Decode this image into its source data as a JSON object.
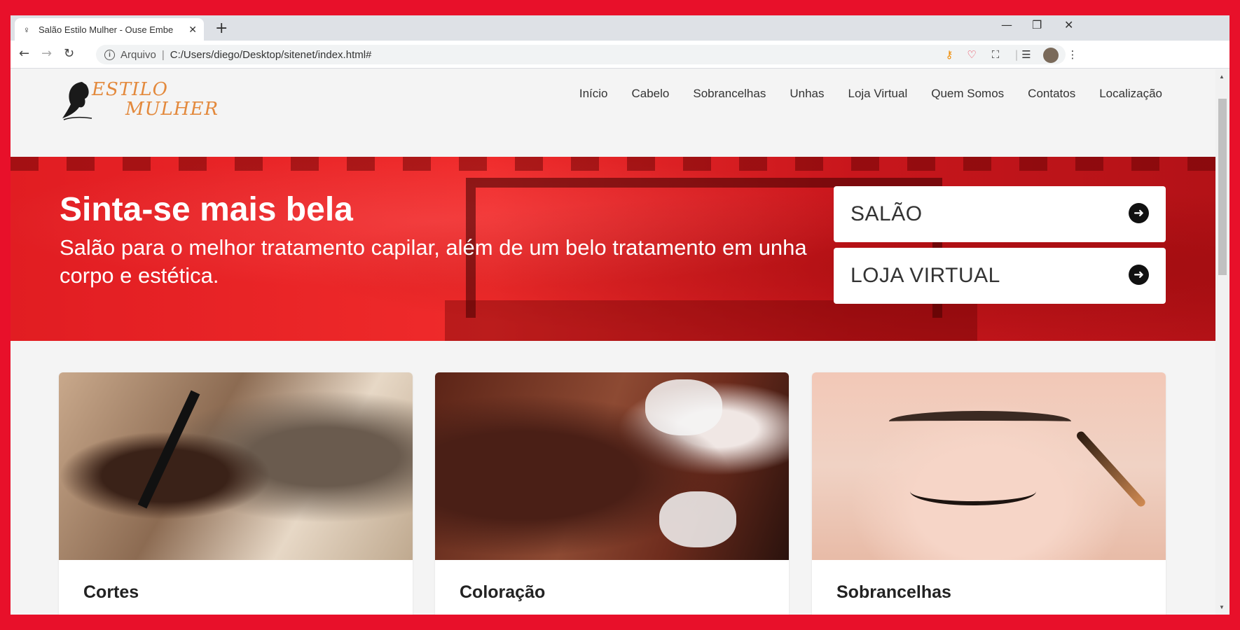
{
  "browser": {
    "tab_title": "Salão Estilo Mulher - Ouse Embe",
    "tab_close": "✕",
    "new_tab": "+",
    "window_controls": {
      "minimize": "—",
      "restore": "❐",
      "close": "✕"
    },
    "nav": {
      "back": "←",
      "forward": "→",
      "reload": "↻"
    },
    "address": {
      "scheme_label": "Arquivo",
      "separator": "|",
      "url": "C:/Users/diego/Desktop/sitenet/index.html#"
    },
    "icons": [
      "info-icon",
      "star-icon",
      "key-extension-icon",
      "heart-extension-icon",
      "screenshot-extension-icon",
      "media-queue-icon",
      "profile-avatar",
      "menu-kebab-icon"
    ],
    "kebab": "⋮"
  },
  "site": {
    "logo": {
      "line1": "ESTILO",
      "line2": "MULHER",
      "color": "#e3893c"
    },
    "menu": [
      "Início",
      "Cabelo",
      "Sobrancelhas",
      "Unhas",
      "Loja Virtual",
      "Quem Somos",
      "Contatos",
      "Localização"
    ],
    "hero": {
      "title": "Sinta-se mais bela",
      "subtitle": "Salão para o melhor tratamento capilar, além de um belo tratamento em unha corpo e estética.",
      "buttons": [
        {
          "label": "SALÃO",
          "icon": "arrow-circle-right-icon"
        },
        {
          "label": "LOJA VIRTUAL",
          "icon": "arrow-circle-right-icon"
        }
      ],
      "color": "#e11d22"
    },
    "cards": [
      {
        "title": "Cortes"
      },
      {
        "title": "Coloração"
      },
      {
        "title": "Sobrancelhas"
      }
    ]
  }
}
